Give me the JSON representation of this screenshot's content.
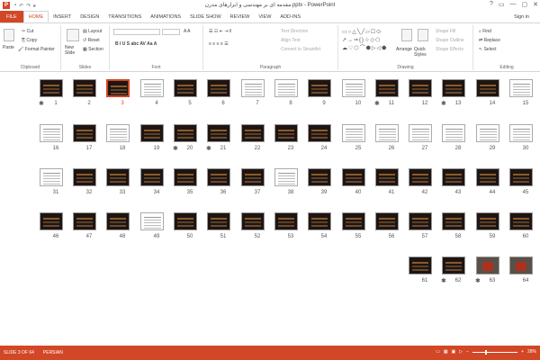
{
  "titlebar": {
    "app_icon": "P",
    "title": "مقدمه ای بر مهندسی و ابزارهای مدرن.pptx - PowerPoint",
    "qat": [
      "save-icon",
      "undo-icon",
      "redo-icon",
      "start-icon"
    ],
    "controls": [
      "?",
      "▭",
      "—",
      "▢",
      "✕"
    ]
  },
  "tabs": [
    "FILE",
    "HOME",
    "INSERT",
    "DESIGN",
    "TRANSITIONS",
    "ANIMATIONS",
    "SLIDE SHOW",
    "REVIEW",
    "VIEW",
    "ADD-INS"
  ],
  "active_tab": "HOME",
  "signin": "Sign in",
  "ribbon": {
    "clipboard": {
      "paste": "Paste",
      "cut": "Cut",
      "copy": "Copy",
      "format_painter": "Format Painter",
      "label": "Clipboard"
    },
    "slides": {
      "new_slide": "New Slide",
      "layout": "Layout",
      "reset": "Reset",
      "section": "Section",
      "label": "Slides"
    },
    "font": {
      "label": "Font",
      "styles": "B  I  U  S  abc  AV  Aa  A"
    },
    "paragraph": {
      "text_direction": "Text Direction",
      "align_text": "Align Text",
      "convert_smartart": "Convert to SmartArt",
      "label": "Paragraph"
    },
    "drawing": {
      "arrange": "Arrange",
      "quick_styles": "Quick Styles",
      "shape_fill": "Shape Fill",
      "shape_outline": "Shape Outline",
      "shape_effects": "Shape Effects",
      "label": "Drawing"
    },
    "editing": {
      "find": "Find",
      "replace": "Replace",
      "select": "Select",
      "label": "Editing"
    }
  },
  "slides": [
    {
      "n": "15",
      "k": "white",
      "star": false
    },
    {
      "n": "14",
      "k": "dark",
      "star": false
    },
    {
      "n": "13",
      "k": "dark",
      "star": true
    },
    {
      "n": "12",
      "k": "dark",
      "star": false
    },
    {
      "n": "11",
      "k": "dark",
      "star": true
    },
    {
      "n": "10",
      "k": "white",
      "star": false
    },
    {
      "n": "9",
      "k": "dark",
      "star": false
    },
    {
      "n": "8",
      "k": "white",
      "star": false
    },
    {
      "n": "7",
      "k": "white",
      "star": false
    },
    {
      "n": "6",
      "k": "dark",
      "star": false
    },
    {
      "n": "5",
      "k": "dark",
      "star": false
    },
    {
      "n": "4",
      "k": "white",
      "star": false
    },
    {
      "n": "3",
      "k": "dark",
      "star": false
    },
    {
      "n": "2",
      "k": "dark",
      "star": false
    },
    {
      "n": "1",
      "k": "dark",
      "star": true
    },
    {
      "n": "30",
      "k": "white",
      "star": false
    },
    {
      "n": "29",
      "k": "white",
      "star": false
    },
    {
      "n": "28",
      "k": "white",
      "star": false
    },
    {
      "n": "27",
      "k": "white",
      "star": false
    },
    {
      "n": "26",
      "k": "white",
      "star": false
    },
    {
      "n": "25",
      "k": "white",
      "star": false
    },
    {
      "n": "24",
      "k": "dark",
      "star": false
    },
    {
      "n": "23",
      "k": "dark",
      "star": false
    },
    {
      "n": "22",
      "k": "dark",
      "star": false
    },
    {
      "n": "21",
      "k": "dark",
      "star": true
    },
    {
      "n": "20",
      "k": "dark",
      "star": true
    },
    {
      "n": "19",
      "k": "dark",
      "star": false
    },
    {
      "n": "18",
      "k": "white",
      "star": false
    },
    {
      "n": "17",
      "k": "dark",
      "star": false
    },
    {
      "n": "16",
      "k": "white",
      "star": false
    },
    {
      "n": "45",
      "k": "dark",
      "star": false
    },
    {
      "n": "44",
      "k": "dark",
      "star": false
    },
    {
      "n": "43",
      "k": "dark",
      "star": false
    },
    {
      "n": "42",
      "k": "dark",
      "star": false
    },
    {
      "n": "41",
      "k": "dark",
      "star": false
    },
    {
      "n": "40",
      "k": "dark",
      "star": false
    },
    {
      "n": "39",
      "k": "dark",
      "star": false
    },
    {
      "n": "38",
      "k": "white",
      "star": false
    },
    {
      "n": "37",
      "k": "dark",
      "star": false
    },
    {
      "n": "36",
      "k": "dark",
      "star": false
    },
    {
      "n": "35",
      "k": "dark",
      "star": false
    },
    {
      "n": "34",
      "k": "dark",
      "star": false
    },
    {
      "n": "33",
      "k": "dark",
      "star": false
    },
    {
      "n": "32",
      "k": "dark",
      "star": false
    },
    {
      "n": "31",
      "k": "white",
      "star": false
    },
    {
      "n": "60",
      "k": "dark",
      "star": false
    },
    {
      "n": "59",
      "k": "dark",
      "star": false
    },
    {
      "n": "58",
      "k": "dark",
      "star": false
    },
    {
      "n": "57",
      "k": "dark",
      "star": false
    },
    {
      "n": "56",
      "k": "dark",
      "star": false
    },
    {
      "n": "55",
      "k": "dark",
      "star": false
    },
    {
      "n": "54",
      "k": "dark",
      "star": false
    },
    {
      "n": "53",
      "k": "dark",
      "star": false
    },
    {
      "n": "52",
      "k": "dark",
      "star": false
    },
    {
      "n": "51",
      "k": "dark",
      "star": false
    },
    {
      "n": "50",
      "k": "dark",
      "star": false
    },
    {
      "n": "49",
      "k": "white",
      "star": false
    },
    {
      "n": "48",
      "k": "dark",
      "star": false
    },
    {
      "n": "47",
      "k": "dark",
      "star": false
    },
    {
      "n": "46",
      "k": "dark",
      "star": false
    },
    {
      "n": "64",
      "k": "photo",
      "star": false
    },
    {
      "n": "63",
      "k": "photo",
      "star": true
    },
    {
      "n": "62",
      "k": "dark",
      "star": true
    },
    {
      "n": "61",
      "k": "dark",
      "star": false
    }
  ],
  "selected_slide": "3",
  "status": {
    "slide_info": "SLIDE 3 OF 64",
    "language": "PERSIAN",
    "zoom": "28%",
    "zoom_level": 0.28
  },
  "colors": {
    "accent": "#d24726"
  }
}
